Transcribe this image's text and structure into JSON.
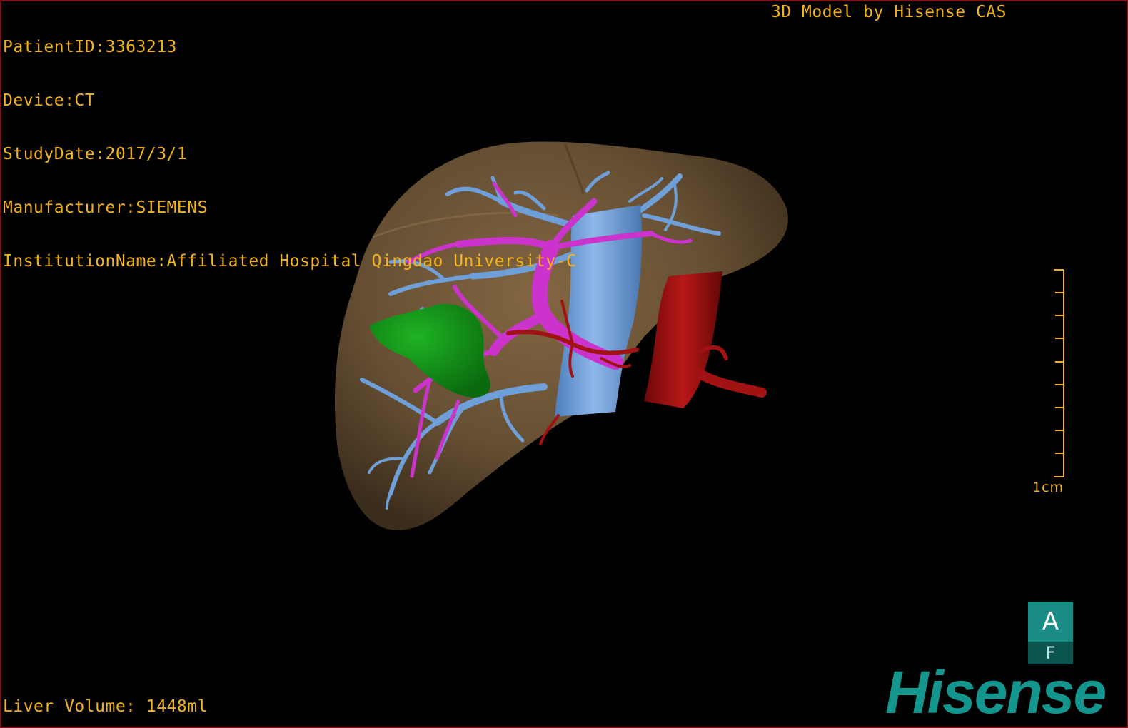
{
  "patient_info": {
    "patient_id": "PatientID:3363213",
    "device": "Device:CT",
    "study_date": "StudyDate:2017/3/1",
    "manufacturer": "Manufacturer:SIEMENS",
    "institution": "InstitutionName:Affiliated Hospital Qingdao University-C"
  },
  "header_right": "3D Model by Hisense CAS",
  "footer": {
    "liver_volume": "Liver Volume: 1448ml"
  },
  "scale_bar": {
    "label": "1cm",
    "tick_count": 10
  },
  "orientation_cube": {
    "top_label": "A",
    "bottom_label": "F"
  },
  "brand": {
    "logo_text": "Hisense"
  },
  "colors": {
    "overlay_text": "#f2b21b",
    "liver": "#6b5336",
    "portal_vein": "#cc33cc",
    "hepatic_vein": "#6f9fd8",
    "artery": "#a11212",
    "tumor": "#0f8c15",
    "brand": "#14968f"
  }
}
